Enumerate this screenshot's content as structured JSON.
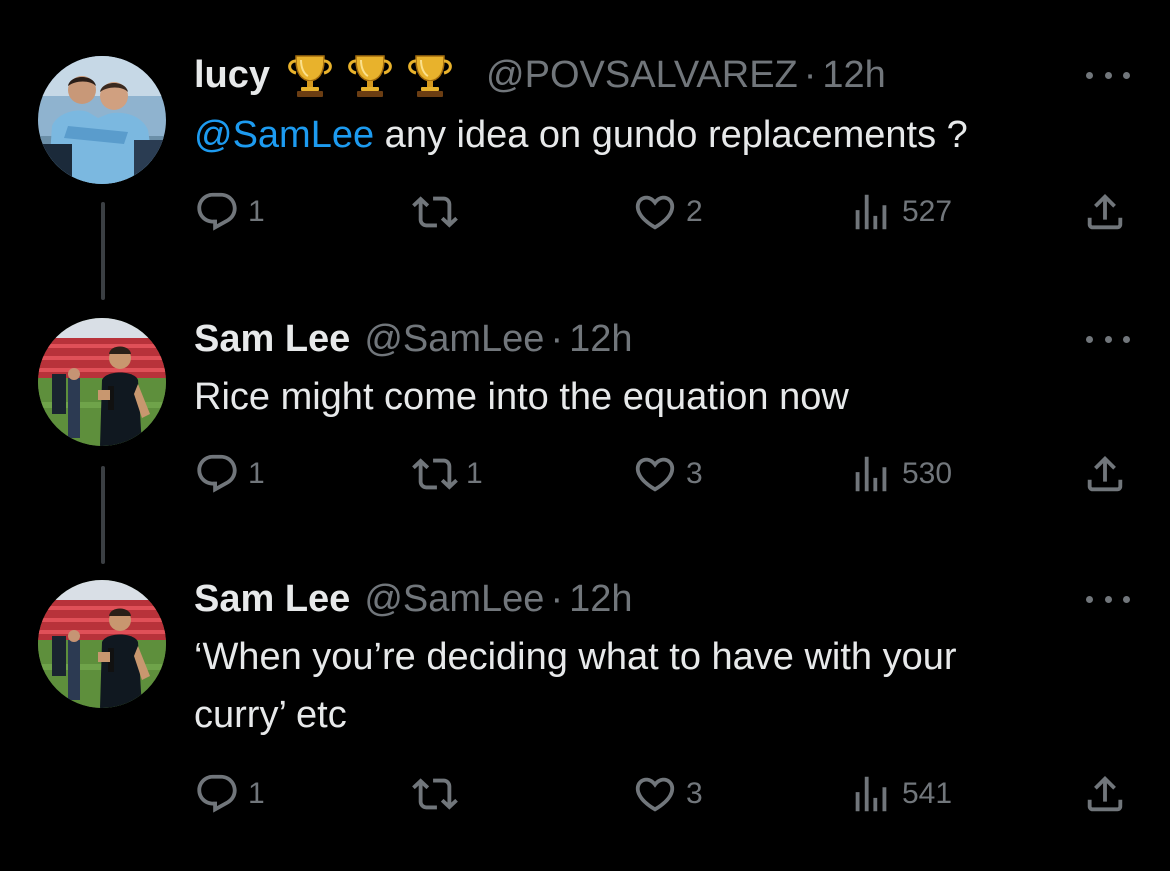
{
  "tweets": [
    {
      "name": "lucy",
      "badges": [
        "trophy-emoji",
        "trophy-emoji",
        "trophy-emoji"
      ],
      "handle": "@POVSALVAREZ",
      "dot": "·",
      "time": "12h",
      "mention": "@SamLee",
      "text": " any idea on gundo replacements ?",
      "replies": "1",
      "retweets": "",
      "likes": "2",
      "views": "527"
    },
    {
      "name": "Sam Lee",
      "handle": "@SamLee",
      "dot": "·",
      "time": "12h",
      "text": "Rice might come into the equation now",
      "replies": "1",
      "retweets": "1",
      "likes": "3",
      "views": "530"
    },
    {
      "name": "Sam Lee",
      "handle": "@SamLee",
      "dot": "·",
      "time": "12h",
      "text_line1": "‘When you’re deciding what to have with your",
      "text_line2": "curry’ etc",
      "replies": "1",
      "retweets": "",
      "likes": "3",
      "views": "541"
    }
  ],
  "colors": {
    "background": "#000000",
    "text": "#e7e9ea",
    "secondary": "#71767b",
    "mention": "#1d9bf0",
    "thread_line": "#3b3f43"
  },
  "icons": [
    "reply-icon",
    "retweet-icon",
    "like-icon",
    "views-icon",
    "share-icon",
    "more-icon"
  ]
}
